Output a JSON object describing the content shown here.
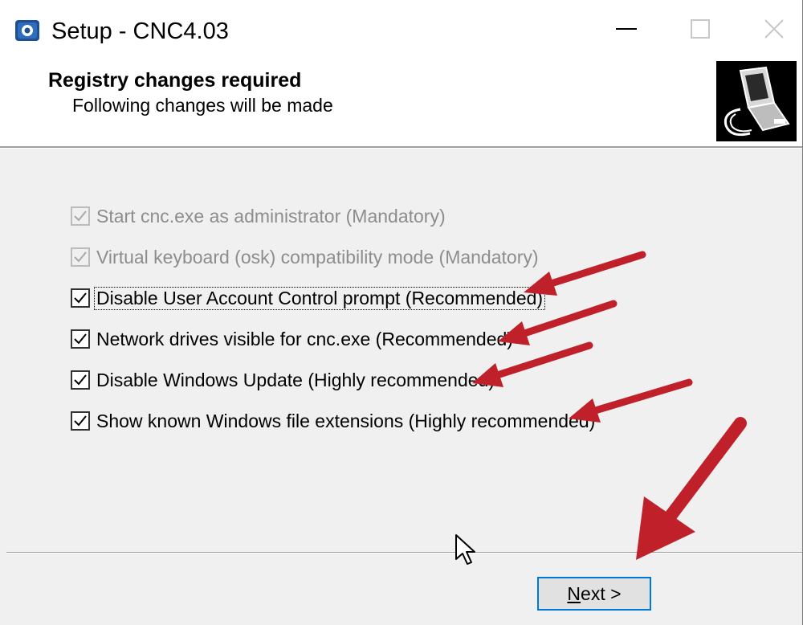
{
  "window": {
    "title": "Setup - CNC4.03",
    "controls": {
      "minimize": "minimize-icon",
      "maximize": "maximize-icon",
      "close": "close-icon"
    }
  },
  "header": {
    "title": "Registry changes required",
    "subtitle": "Following changes will be made"
  },
  "options": [
    {
      "label": "Start cnc.exe as administrator (Mandatory)",
      "checked": true,
      "disabled": true
    },
    {
      "label": "Virtual keyboard (osk) compatibility mode (Mandatory)",
      "checked": true,
      "disabled": true
    },
    {
      "label": "Disable User Account Control prompt (Recommended)",
      "checked": true,
      "disabled": false
    },
    {
      "label": "Network drives visible for cnc.exe (Recommended)",
      "checked": true,
      "disabled": false
    },
    {
      "label": "Disable Windows Update (Highly recommended)",
      "checked": true,
      "disabled": false
    },
    {
      "label": "Show known Windows file extensions (Highly recommended)",
      "checked": true,
      "disabled": false
    }
  ],
  "footer": {
    "next_accel": "N",
    "next_rest": "ext >"
  },
  "colors": {
    "annotation_arrow": "#c0202a",
    "focus_border": "#0078d7",
    "disabled_text": "#8d8d8d"
  }
}
